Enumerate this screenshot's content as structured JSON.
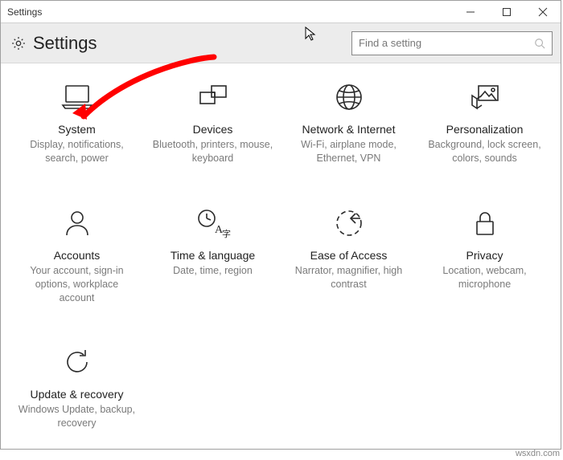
{
  "titlebar": {
    "title": "Settings"
  },
  "header": {
    "title": "Settings",
    "search_placeholder": "Find a setting"
  },
  "tiles": [
    {
      "title": "System",
      "desc": "Display, notifications, search, power"
    },
    {
      "title": "Devices",
      "desc": "Bluetooth, printers, mouse, keyboard"
    },
    {
      "title": "Network & Internet",
      "desc": "Wi-Fi, airplane mode, Ethernet, VPN"
    },
    {
      "title": "Personalization",
      "desc": "Background, lock screen, colors, sounds"
    },
    {
      "title": "Accounts",
      "desc": "Your account, sign-in options, workplace account"
    },
    {
      "title": "Time & language",
      "desc": "Date, time, region"
    },
    {
      "title": "Ease of Access",
      "desc": "Narrator, magnifier, high contrast"
    },
    {
      "title": "Privacy",
      "desc": "Location, webcam, microphone"
    },
    {
      "title": "Update & recovery",
      "desc": "Windows Update, backup, recovery"
    }
  ],
  "watermark": "wsxdn.com"
}
